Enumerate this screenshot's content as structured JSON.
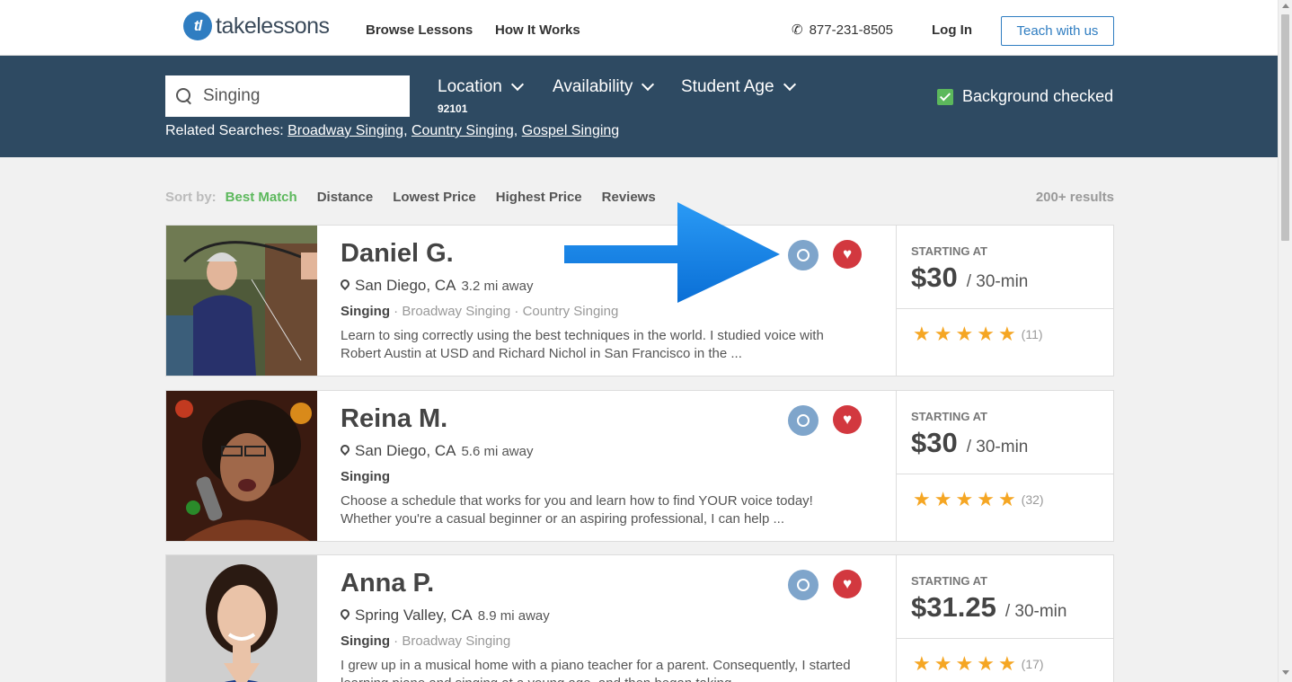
{
  "header": {
    "logo_mark": "tl",
    "logo_text": "takelessons",
    "nav": [
      "Browse Lessons",
      "How It Works"
    ],
    "phone": "877-231-8505",
    "login": "Log In",
    "teach_button": "Teach with us"
  },
  "search": {
    "value": "Singing",
    "filters": {
      "location": "Location",
      "location_value": "92101",
      "availability": "Availability",
      "student_age": "Student Age"
    },
    "background_checked": "Background checked",
    "related_label": "Related Searches:",
    "related": [
      "Broadway Singing",
      "Country Singing",
      "Gospel Singing"
    ]
  },
  "sort": {
    "label": "Sort by:",
    "options": [
      "Best Match",
      "Distance",
      "Lowest Price",
      "Highest Price",
      "Reviews"
    ],
    "active": "Best Match",
    "results": "200+ results"
  },
  "teachers": [
    {
      "name": "Daniel G.",
      "city": "San Diego, CA",
      "distance": "3.2 mi away",
      "main_subject": "Singing",
      "other_subjects": "· Broadway Singing · Country Singing",
      "description": "Learn to sing correctly using the best techniques in the world. I studied voice with Robert Austin at USD and Richard Nichol in San Francisco in the ...",
      "starting_at": "STARTING AT",
      "price": "$30",
      "per": "/ 30-min",
      "rating": 5,
      "reviews": "(11)"
    },
    {
      "name": "Reina M.",
      "city": "San Diego, CA",
      "distance": "5.6 mi away",
      "main_subject": "Singing",
      "other_subjects": "",
      "description": "Choose a schedule that works for you and learn how to find YOUR voice today! Whether you're a casual beginner or an aspiring professional, I can help ...",
      "starting_at": "STARTING AT",
      "price": "$30",
      "per": "/ 30-min",
      "rating": 5,
      "reviews": "(32)"
    },
    {
      "name": "Anna P.",
      "city": "Spring Valley, CA",
      "distance": "8.9 mi away",
      "main_subject": "Singing",
      "other_subjects": "· Broadway Singing",
      "description": "I grew up in a musical home with a piano teacher for a parent. Consequently, I started learning piano and singing at a young age, and then began taking ...",
      "starting_at": "STARTING AT",
      "price": "$31.25",
      "per": "/ 30-min",
      "rating": 5,
      "reviews": "(17)"
    }
  ],
  "colors": {
    "brand_blue": "#2f7dc1",
    "search_bar": "#2e4a62",
    "accent_green": "#5cb85c",
    "heart_red": "#d2383f",
    "badge_blue": "#7fa5cb",
    "star": "#f5a623",
    "annotation_arrow": "#1a86e8"
  },
  "icons": [
    "phone-icon",
    "search-icon",
    "chevron-down-icon",
    "checkbox-icon",
    "pin-icon",
    "badge-icon",
    "heart-icon",
    "star-icon",
    "arrow-annotation"
  ]
}
